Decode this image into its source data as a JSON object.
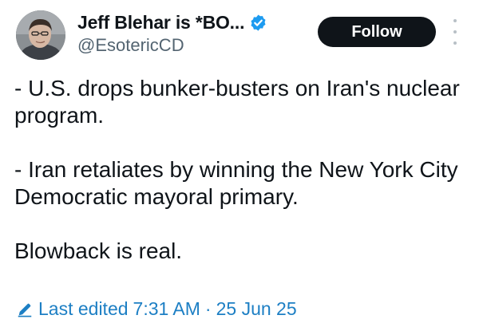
{
  "user": {
    "display_name": "Jeff Blehar is *BO...",
    "handle": "@EsotericCD",
    "verified": true
  },
  "actions": {
    "follow_label": "Follow",
    "more_icon": "more-vertical-icon"
  },
  "tweet": {
    "paragraphs": [
      "- U.S. drops bunker-busters on Iran's nuclear program.",
      "- Iran retaliates by winning the New York City Democratic mayoral primary.",
      "Blowback is real."
    ]
  },
  "edit_info": {
    "icon": "pencil-icon",
    "label": "Last edited",
    "time": "7:31 AM",
    "separator": "·",
    "date": "25 Jun 25"
  },
  "colors": {
    "verified_badge": "#1d9bf0",
    "link": "#1d7fc4",
    "button_bg": "#0f1419",
    "secondary_text": "#536471"
  }
}
